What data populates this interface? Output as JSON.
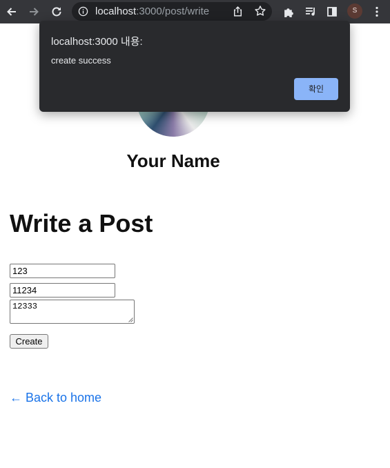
{
  "browser": {
    "url_host": "localhost",
    "url_path": ":3000/post/write",
    "profile_initial": "S"
  },
  "profile": {
    "name": "Your Name"
  },
  "page": {
    "title": "Write a Post"
  },
  "form": {
    "title_value": "123",
    "subtitle_value": "11234",
    "content_value": "12333",
    "create_label": "Create"
  },
  "back_link": "← Back to home",
  "dialog": {
    "title": "localhost:3000 내용:",
    "message": "create success",
    "ok_label": "확인"
  },
  "icons": {
    "back": "arrow-left-icon",
    "forward": "arrow-right-icon",
    "reload": "reload-icon",
    "info": "info-icon",
    "share": "share-icon",
    "bookmark": "star-icon",
    "extensions": "puzzle-icon",
    "media": "media-queue-icon",
    "side_panel": "side-panel-icon",
    "menu": "kebab-menu-icon"
  },
  "colors": {
    "toolbar": "#35363a",
    "omnibox": "#202124",
    "dialog": "#292a2d",
    "dialog_button": "#8ab4f8",
    "link": "#1a73e8"
  }
}
